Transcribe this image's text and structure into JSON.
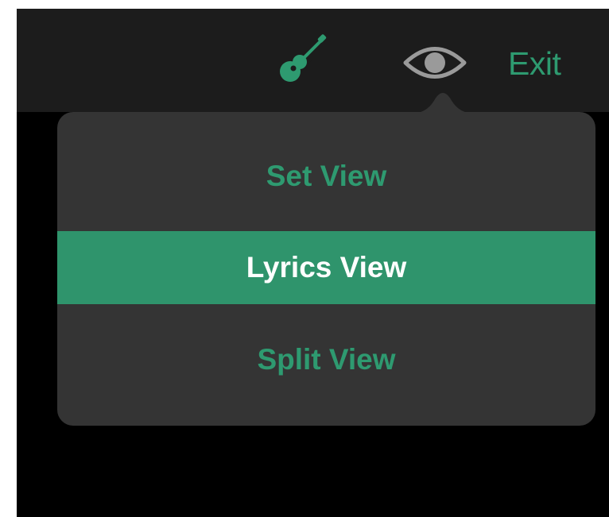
{
  "topbar": {
    "icons": {
      "guitar": "guitar-icon",
      "eye": "eye-icon"
    },
    "exit_label": "Exit"
  },
  "view_menu": {
    "items": [
      {
        "label": "Set View",
        "selected": false
      },
      {
        "label": "Lyrics View",
        "selected": true
      },
      {
        "label": "Split View",
        "selected": false
      }
    ]
  },
  "colors": {
    "accent": "#2e9a70",
    "selected_background": "#2f946c",
    "toolbar_background": "#1c1c1c",
    "popover_background": "#343434",
    "screen_background": "#000000",
    "eye_icon": "#9a9a9a"
  }
}
